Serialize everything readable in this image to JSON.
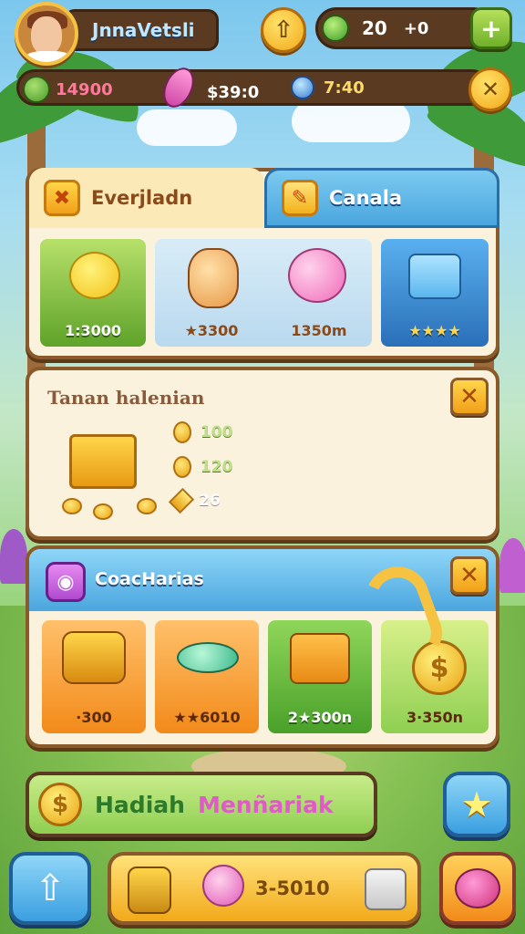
{
  "top": {
    "player_name": "JnnaVetsli",
    "upgrade_icon": "up-arrow-icon",
    "gems": "20",
    "gems_delta": "+0",
    "add_label": "+",
    "resource_1": "14900",
    "resource_2": "$39:0",
    "resource_3": "7:40",
    "close_label": "✕"
  },
  "shop": {
    "tab_active": "Everjladn",
    "tab_other": "Canala",
    "items": [
      {
        "value": "1:3000",
        "icon": "lemon-creature-icon"
      },
      {
        "value": "★3300",
        "icon": "teddy-bear-icon"
      },
      {
        "value": "1350m",
        "icon": "pink-balloon-icon"
      },
      {
        "value": "★★★★",
        "icon": "gift-box-icon"
      }
    ]
  },
  "treasure": {
    "title": "Tanan halenian",
    "close_label": "✕",
    "rows": [
      {
        "value": "100",
        "icon": "coin-icon"
      },
      {
        "value": "120",
        "icon": "coin-icon"
      },
      {
        "value": "26",
        "icon": "gem-icon"
      }
    ]
  },
  "coach": {
    "title": "CoacHarias",
    "close_label": "✕",
    "items": [
      {
        "value": "·300",
        "icon": "coin-basket-icon"
      },
      {
        "value": "★★6010",
        "icon": "candy-icon"
      },
      {
        "value": "2★300n",
        "icon": "treasure-chest-icon"
      },
      {
        "value": "3·350n",
        "icon": "dollar-coin-icon"
      }
    ]
  },
  "banner": {
    "text_1": "Hadiah",
    "text_2": "Menñariak"
  },
  "bottom": {
    "amount": "3-5010"
  },
  "colors": {
    "panel_border": "#8a5a2b",
    "accent_gold": "#f2a91a",
    "accent_blue": "#3a9fe0"
  }
}
